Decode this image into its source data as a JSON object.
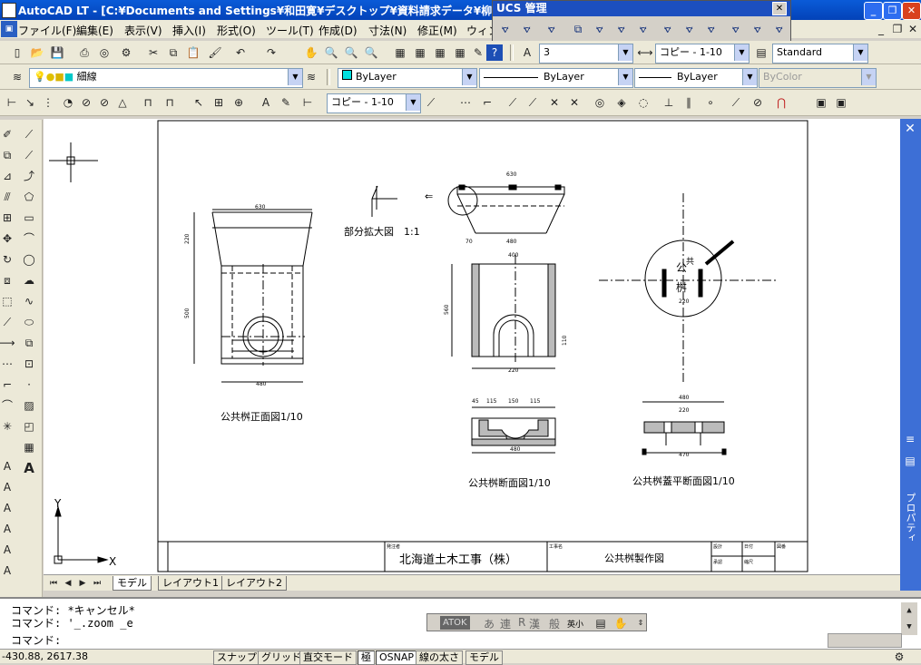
{
  "window": {
    "title": "AutoCAD LT - [C:¥Documents and Settings¥和田寛¥デスクトップ¥資料請求データ¥柳"
  },
  "ucs_toolbar": {
    "title": "UCS 管理"
  },
  "menu": [
    "ファイル(F)",
    "編集(E)",
    "表示(V)",
    "挿入(I)",
    "形式(O)",
    "ツール(T)",
    "作成(D)",
    "寸法(N)",
    "修正(M)",
    "ウィン"
  ],
  "toolbar": {
    "text_style_value": "3",
    "dim_style_value": "コピー - 1-10",
    "table_style_value": "Standard",
    "layer_value": "細線",
    "color_value": "ByLayer",
    "linetype_value": "ByLayer",
    "lineweight_value": "ByLayer",
    "plotstyle_value": "ByColor",
    "dim_style_value2": "コピー - 1-10"
  },
  "drawing": {
    "view_front": "公共桝正面図1/10",
    "view_detail": "部分拡大図　1:1",
    "view_section": "公共桝断面図1/10",
    "view_lid": "公共桝蓋平断面図1/10",
    "lid_mark_1": "公",
    "lid_mark_2": "共",
    "lid_mark_3": "桝",
    "titleblock_company": "北海道土木工事（株）",
    "titleblock_drawing": "公共桝製作図",
    "titleblock_company_label": "発注者",
    "titleblock_drawing_label": "工事名",
    "tb_h1": "設計",
    "tb_h2": "日付",
    "tb_h3": "図番",
    "tb_h4": "承認",
    "tb_h5": "縮尺",
    "dims": {
      "d630": "630",
      "d500": "500",
      "d220": "220",
      "d560": "560",
      "d480": "480",
      "d400": "400",
      "d90": "90",
      "d100": "100",
      "d150": "150",
      "d115": "115",
      "d45": "45",
      "d470": "470",
      "d110": "110",
      "d40": "40",
      "d70": "70",
      "d15": "15",
      "d30": "30",
      "d5": "5",
      "d60": "60",
      "d2": "2"
    },
    "axis_x": "X",
    "axis_y": "Y"
  },
  "tabs": [
    "モデル",
    "レイアウト1",
    "レイアウト2"
  ],
  "right_panel": {
    "label": "プロパティ"
  },
  "command": {
    "line1": "コマンド: *キャンセル*",
    "line2": "コマンド: '_.zoom _e",
    "prompt": "コマンド:"
  },
  "ime": {
    "mode": "ATOK",
    "k1": "あ",
    "k2": "連",
    "k3": "R",
    "k4": "漢",
    "k5": "般",
    "k6": "英小"
  },
  "status": {
    "coords": "-430.88, 2617.38",
    "buttons": [
      "スナップ",
      "グリッド",
      "直交モード",
      "極",
      "OSNAP",
      "線の太さ",
      "モデル"
    ]
  },
  "colors": {
    "titlebar": "#0a5bd8",
    "right_panel": "#3d6fd6",
    "canvas": "#ffffff"
  }
}
